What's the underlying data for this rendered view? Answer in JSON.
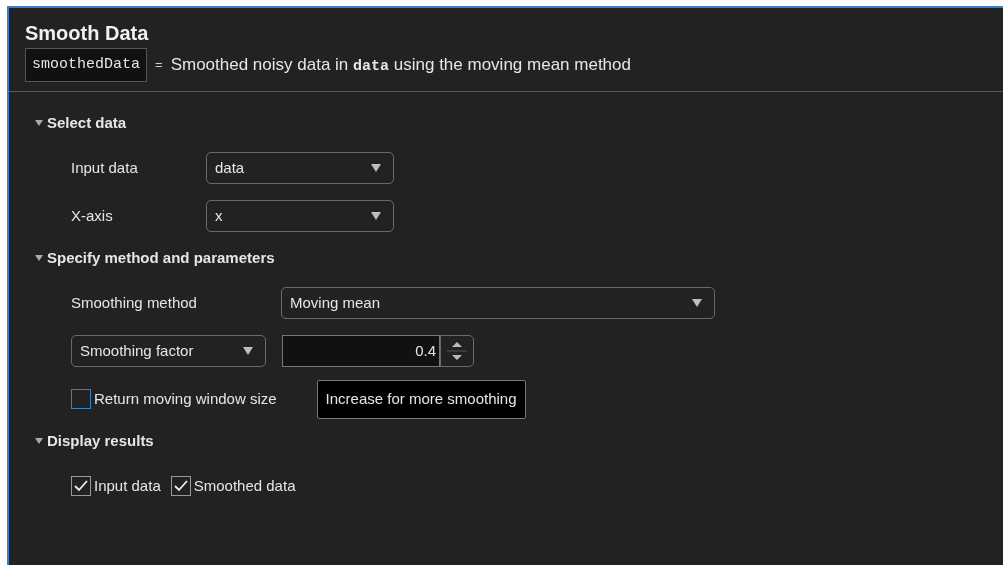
{
  "title": "Smooth Data",
  "output": {
    "variable": "smoothedData",
    "equals": "=",
    "summary": "Smoothed noisy data in **data** using the moving mean method"
  },
  "sections": [
    {
      "title": "Select data",
      "expanded": true,
      "rows": [
        {
          "kind": "dropdown",
          "label": "Input data",
          "value": "data"
        },
        {
          "kind": "dropdown",
          "label": "X-axis",
          "value": "x"
        }
      ]
    },
    {
      "title": "Specify method and parameters",
      "expanded": true,
      "rows": [
        {
          "kind": "dropdown",
          "label": "Smoothing method",
          "value": "Moving mean"
        },
        {
          "kind": "spinner",
          "selector": "Smoothing factor",
          "value": "0.4"
        },
        {
          "kind": "checkboxes",
          "items": [
            {
              "label": "Return moving window size",
              "checked": false,
              "focused": true
            }
          ],
          "tooltip": "Increase for more smoothing"
        }
      ]
    },
    {
      "title": "Display results",
      "expanded": true,
      "rows": [
        {
          "kind": "checkboxes",
          "items": [
            {
              "label": "Input data",
              "checked": true,
              "focused": false
            },
            {
              "label": "Smoothed data",
              "checked": true,
              "focused": false
            }
          ]
        }
      ]
    }
  ]
}
